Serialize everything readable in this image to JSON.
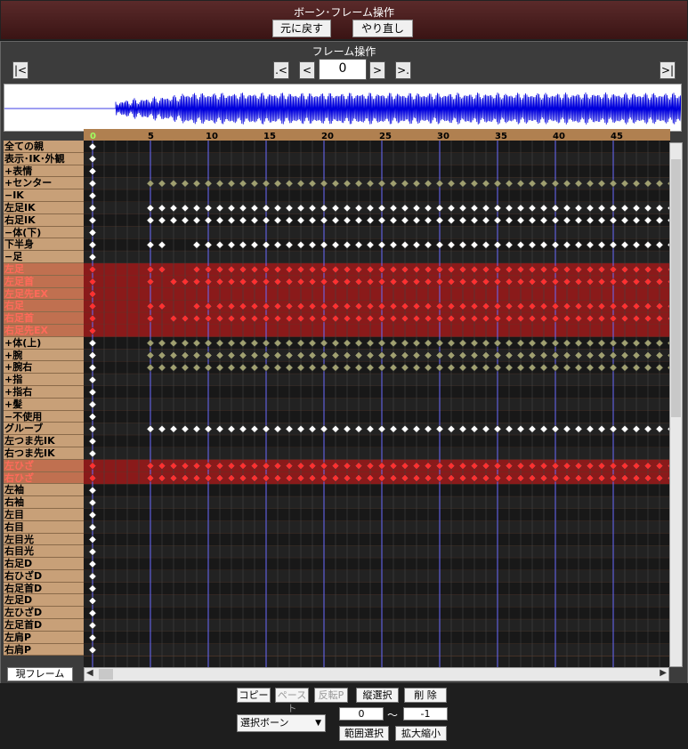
{
  "bone_panel": {
    "title": "ボーン･フレーム操作",
    "undo_label": "元に戻す",
    "redo_label": "やり直し"
  },
  "frame_panel": {
    "title": "フレーム操作",
    "first_label": "|<",
    "prev_key_label": ".<",
    "prev_label": "<",
    "frame_value": "0",
    "next_label": ">",
    "next_key_label": ">.",
    "last_label": ">|"
  },
  "ruler": {
    "labels": [
      "0",
      "5",
      "10",
      "15",
      "20",
      "25",
      "30",
      "35",
      "40",
      "45"
    ]
  },
  "bones": [
    {
      "name": "全ての親",
      "red": false
    },
    {
      "name": "表示･IK･外観",
      "red": false
    },
    {
      "name": "+表情",
      "red": false
    },
    {
      "name": "+センター",
      "red": false
    },
    {
      "name": "−IK",
      "red": false
    },
    {
      "name": "左足IK",
      "red": false
    },
    {
      "name": "右足IK",
      "red": false
    },
    {
      "name": "−体(下)",
      "red": false
    },
    {
      "name": "下半身",
      "red": false
    },
    {
      "name": "−足",
      "red": false
    },
    {
      "name": "左足",
      "red": true
    },
    {
      "name": "左足首",
      "red": true
    },
    {
      "name": "左足先EX",
      "red": true
    },
    {
      "name": "右足",
      "red": true
    },
    {
      "name": "右足首",
      "red": true
    },
    {
      "name": "右足先EX",
      "red": true
    },
    {
      "name": "+体(上)",
      "red": false
    },
    {
      "name": "+腕",
      "red": false
    },
    {
      "name": "+腕右",
      "red": false
    },
    {
      "name": "+指",
      "red": false
    },
    {
      "name": "+指右",
      "red": false
    },
    {
      "name": "+髪",
      "red": false
    },
    {
      "name": "−不使用",
      "red": false
    },
    {
      "name": "グルーブ",
      "red": false
    },
    {
      "name": "左つま先IK",
      "red": false
    },
    {
      "name": "右つま先IK",
      "red": false
    },
    {
      "name": "左ひざ",
      "red": true
    },
    {
      "name": "右ひざ",
      "red": true
    },
    {
      "name": "左袖",
      "red": false
    },
    {
      "name": "右袖",
      "red": false
    },
    {
      "name": "左目",
      "red": false
    },
    {
      "name": "右目",
      "red": false
    },
    {
      "name": "左目光",
      "red": false
    },
    {
      "name": "右目光",
      "red": false
    },
    {
      "name": "右足D",
      "red": false
    },
    {
      "name": "右ひざD",
      "red": false
    },
    {
      "name": "右足首D",
      "red": false
    },
    {
      "name": "左足D",
      "red": false
    },
    {
      "name": "左ひざD",
      "red": false
    },
    {
      "name": "左足首D",
      "red": false
    },
    {
      "name": "左肩P",
      "red": false
    },
    {
      "name": "右肩P",
      "red": false
    }
  ],
  "current_frame_label": "現フレーム",
  "bottom": {
    "copy_label": "コピー",
    "paste_label": "ペースト",
    "flip_paste_label": "反転P",
    "vertical_select_label": "縦選択",
    "delete_label": "削 除",
    "select_value": "選択ボーン",
    "range_from": "0",
    "range_sep": "〜",
    "range_to": "-1",
    "range_select_label": "範囲選択",
    "scale_label": "拡大縮小"
  },
  "colors": {
    "key_white": "#ffffff",
    "key_olive": "#a0a070",
    "key_red": "#ff3030",
    "grid_line": "#6a6aff"
  }
}
